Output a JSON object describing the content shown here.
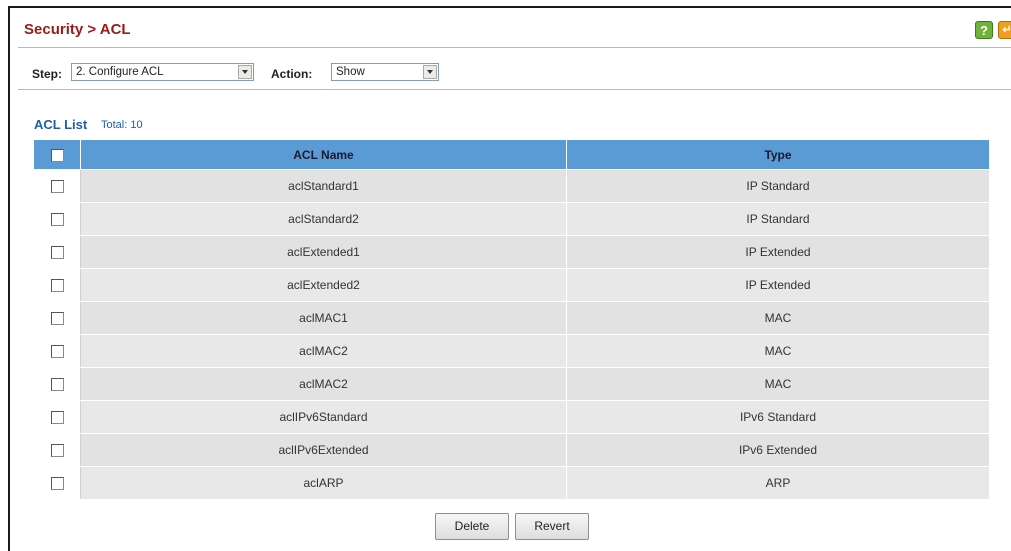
{
  "header": {
    "title": "Security > ACL",
    "help_label": "?",
    "extra_label": "↵"
  },
  "toolbar": {
    "step_label": "Step:",
    "step_value": "2. Configure ACL",
    "action_label": "Action:",
    "action_value": "Show"
  },
  "list": {
    "title": "ACL List",
    "total": "Total: 10",
    "columns": [
      "ACL Name",
      "Type"
    ],
    "rows": [
      {
        "name": "aclStandard1",
        "type": "IP Standard"
      },
      {
        "name": "aclStandard2",
        "type": "IP Standard"
      },
      {
        "name": "aclExtended1",
        "type": "IP Extended"
      },
      {
        "name": "aclExtended2",
        "type": "IP Extended"
      },
      {
        "name": "aclMAC1",
        "type": "MAC"
      },
      {
        "name": "aclMAC2",
        "type": "MAC"
      },
      {
        "name": "aclMAC2",
        "type": "MAC"
      },
      {
        "name": "aclIPv6Standard",
        "type": "IPv6 Standard"
      },
      {
        "name": "aclIPv6Extended",
        "type": "IPv6 Extended"
      },
      {
        "name": "aclARP",
        "type": "ARP"
      }
    ]
  },
  "buttons": {
    "delete": "Delete",
    "revert": "Revert"
  },
  "colors": {
    "title": "#9a1b1b",
    "header_bg": "#5b9bd5",
    "link_blue": "#1e5fa8",
    "row_bg": "#e2e2e2"
  }
}
